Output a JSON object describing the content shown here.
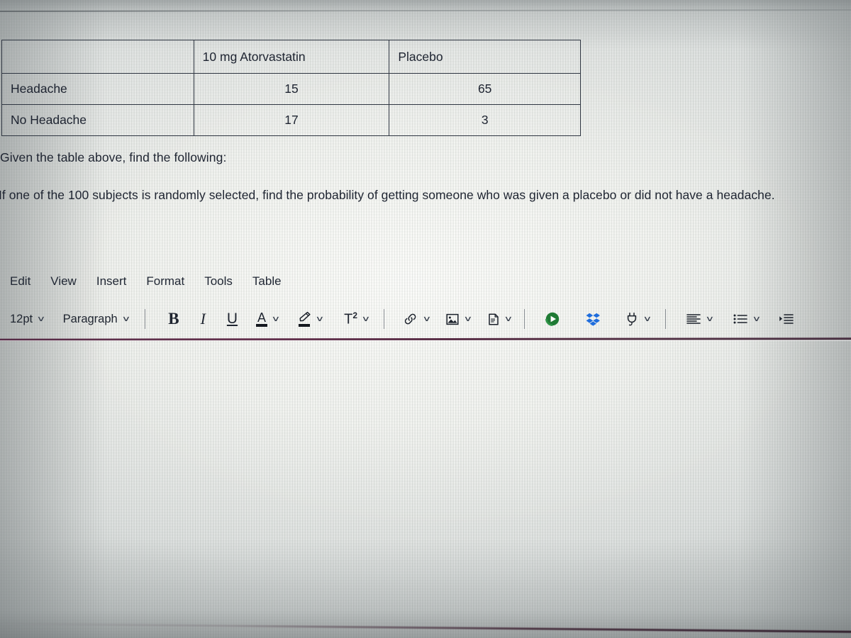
{
  "document": {
    "table": {
      "header_row": [
        "",
        "10 mg Atorvastatin",
        "Placebo"
      ],
      "rows": [
        {
          "label": "Headache",
          "atorvastatin": "15",
          "placebo": "65"
        },
        {
          "label": "No Headache",
          "atorvastatin": "17",
          "placebo": "3"
        }
      ]
    },
    "prompt_line_1": "Given the table above, find the following:",
    "prompt_line_2": "If one of the 100 subjects is randomly selected, find the probability of getting someone who was given a placebo or did not have a headache."
  },
  "menu": {
    "items": [
      {
        "label": "Edit"
      },
      {
        "label": "View"
      },
      {
        "label": "Insert"
      },
      {
        "label": "Format"
      },
      {
        "label": "Tools"
      },
      {
        "label": "Table"
      }
    ]
  },
  "toolbar": {
    "font_size": "12pt",
    "paragraph_style": "Paragraph",
    "bold": "B",
    "italic": "I",
    "underline": "U",
    "text_color": "A",
    "superscript": "T",
    "superscript_exp": "2",
    "chevron": "∨",
    "icons": {
      "text_color": "text-color-icon",
      "highlighter": "highlighter-icon",
      "superscript": "superscript-icon",
      "link": "link-icon",
      "image": "image-icon",
      "document": "document-icon",
      "media": "media-play-icon",
      "dropbox": "dropbox-icon",
      "plugin": "plug-icon",
      "align": "align-left-icon",
      "bullet_list": "bullet-list-icon",
      "indent": "indent-icon"
    }
  },
  "colors": {
    "table_border": "#2f3642",
    "text": "#1e2431",
    "editor_rule": "#4d1f3c",
    "dropbox_blue": "#1f6ddd",
    "media_green": "#1f7a34"
  }
}
